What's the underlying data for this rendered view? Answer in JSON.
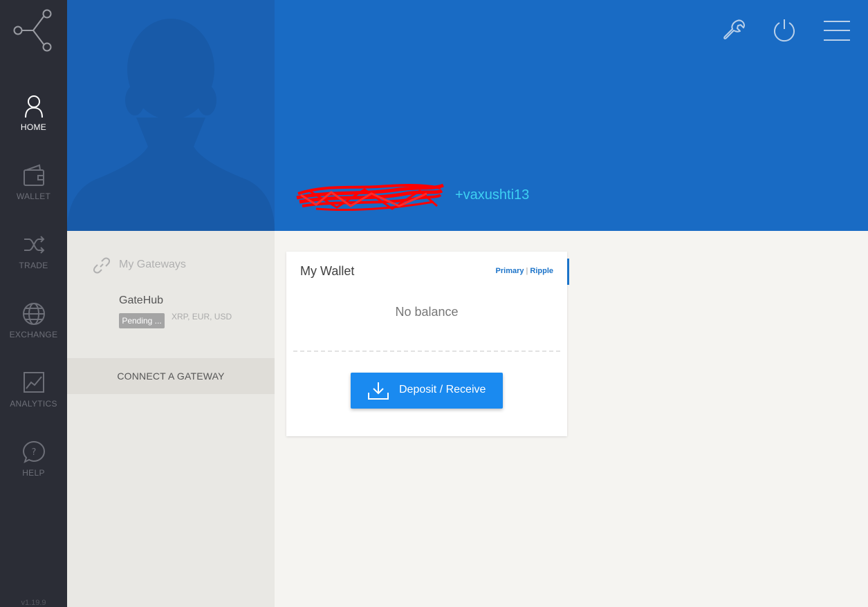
{
  "app": {
    "logo_icon": "share-nodes-icon",
    "version": "v1.19.9"
  },
  "nav": {
    "items": [
      {
        "label": "HOME",
        "icon": "user-icon",
        "active": true
      },
      {
        "label": "WALLET",
        "icon": "wallet-icon",
        "active": false
      },
      {
        "label": "TRADE",
        "icon": "shuffle-icon",
        "active": false
      },
      {
        "label": "EXCHANGE",
        "icon": "globe-icon",
        "active": false
      },
      {
        "label": "ANALYTICS",
        "icon": "chart-icon",
        "active": false
      },
      {
        "label": "HELP",
        "icon": "help-bubble-icon",
        "active": false
      }
    ]
  },
  "header": {
    "handle": "+vaxushti13",
    "icons": [
      "wrench-icon",
      "power-icon",
      "menu-icon"
    ]
  },
  "gateways": {
    "title": "My Gateways",
    "items": [
      {
        "name": "GateHub",
        "status": "Pending ...",
        "currencies": "XRP, EUR, USD"
      }
    ],
    "connect_label": "CONNECT A GATEWAY"
  },
  "wallet": {
    "title": "My Wallet",
    "link_primary": "Primary",
    "link_separator": "|",
    "link_ripple": "Ripple",
    "balance_text": "No balance",
    "deposit_label": "Deposit / Receive"
  },
  "colors": {
    "nav_bg": "#2b2d36",
    "header_bg": "#196bc4",
    "accent": "#1b73c9",
    "handle": "#3ed0f2",
    "button": "#1a8af0"
  }
}
